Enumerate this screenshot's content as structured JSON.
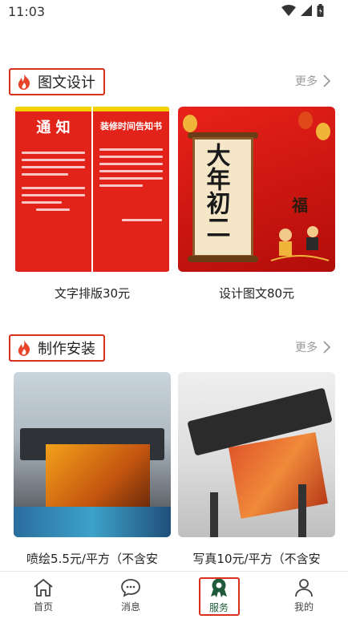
{
  "status_bar": {
    "time": "11:03"
  },
  "sections": [
    {
      "title": "图文设计",
      "more": "更多",
      "items": [
        {
          "caption": "文字排版30元",
          "poster": {
            "left_title": "通 知",
            "right_title": "装修时间告知书"
          }
        },
        {
          "caption": "设计图文80元",
          "poster": {
            "calligraphy": "大年初二"
          }
        }
      ]
    },
    {
      "title": "制作安装",
      "more": "更多",
      "items": [
        {
          "caption": "喷绘5.5元/平方（不含安"
        },
        {
          "caption": "写真10元/平方（不含安"
        }
      ]
    }
  ],
  "tabs": [
    {
      "label": "首页",
      "icon": "home-icon"
    },
    {
      "label": "消息",
      "icon": "message-icon"
    },
    {
      "label": "服务",
      "icon": "service-icon"
    },
    {
      "label": "我的",
      "icon": "user-icon"
    }
  ],
  "active_tab": "服务",
  "colors": {
    "accent_red": "#d9301d",
    "active_tab": "#1f5a3a",
    "more_gray": "#9a9a9a"
  }
}
